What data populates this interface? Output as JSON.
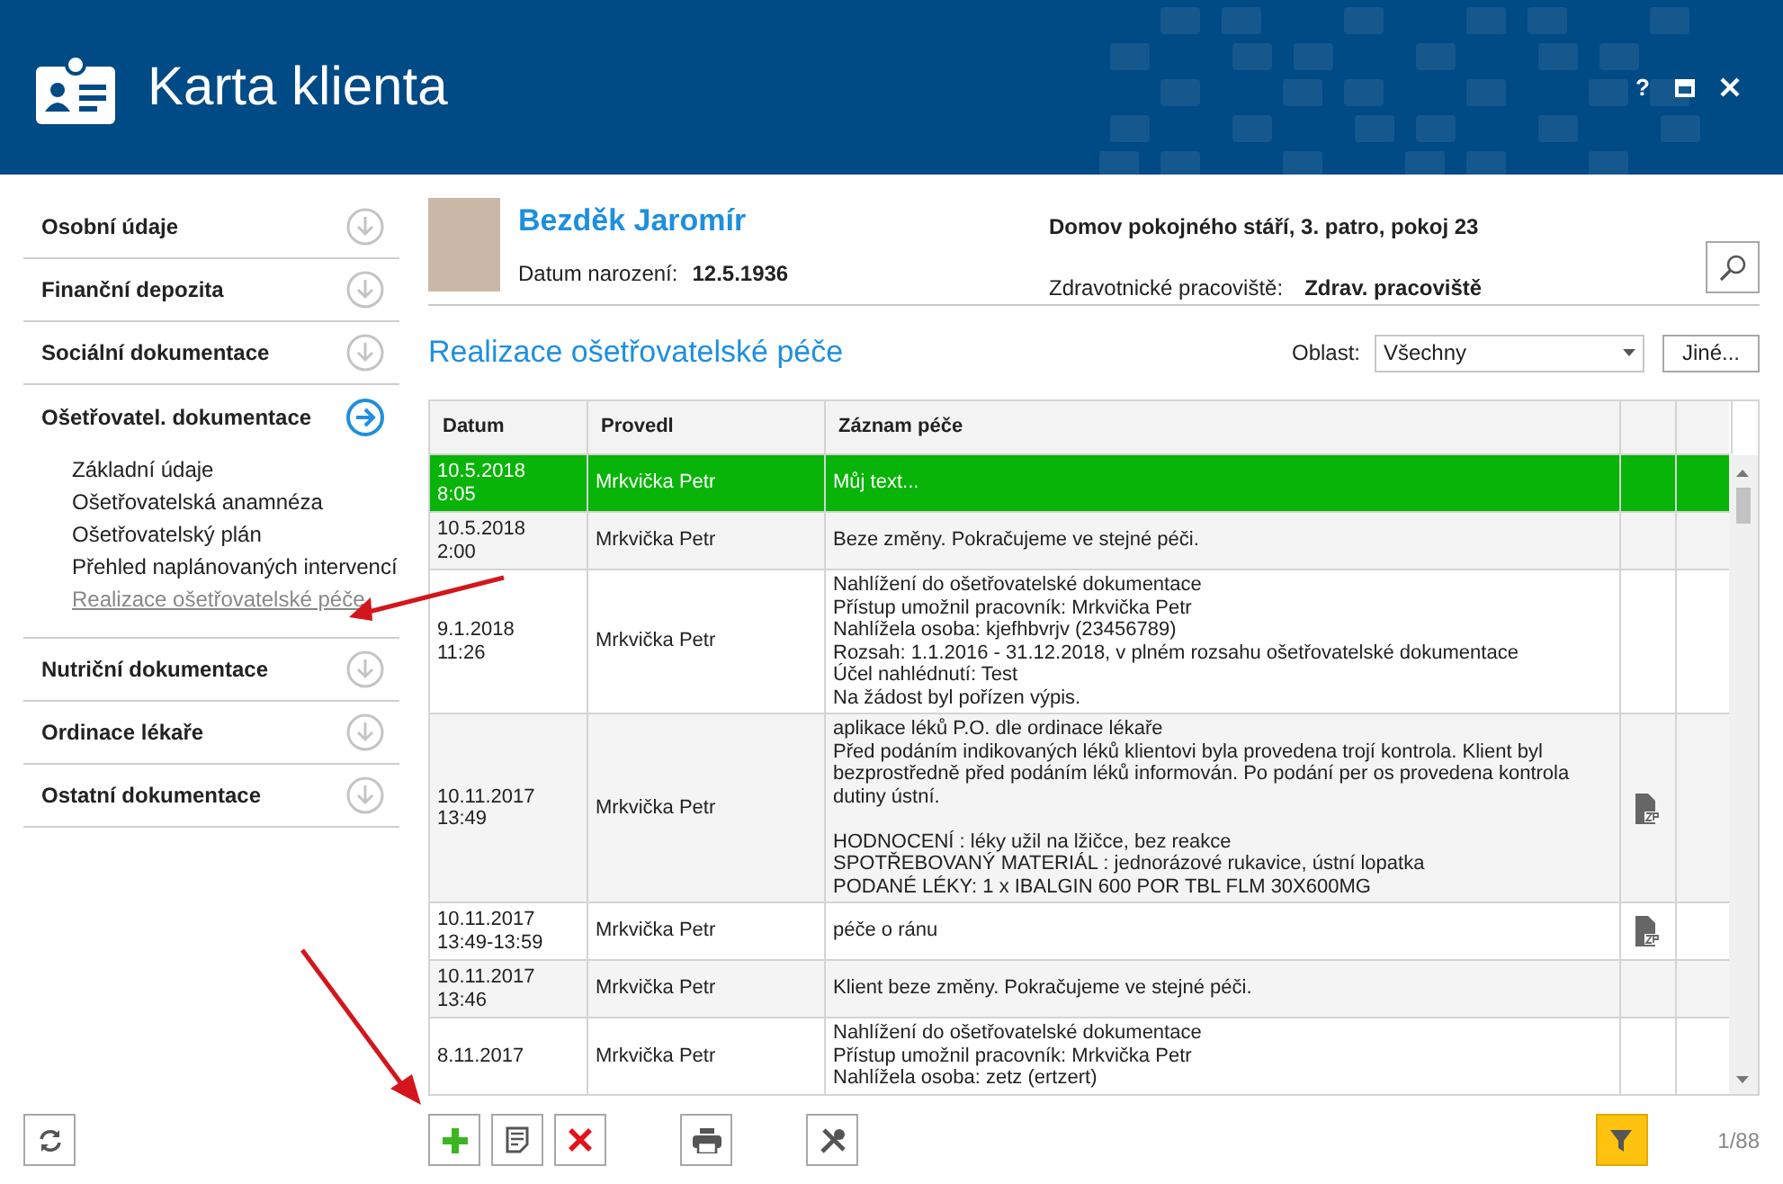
{
  "window": {
    "title": "Karta klienta",
    "help": "?"
  },
  "sidebar": {
    "sections": [
      {
        "label": "Osobní údaje",
        "expanded": false
      },
      {
        "label": "Finanční depozita",
        "expanded": false
      },
      {
        "label": "Sociální dokumentace",
        "expanded": false
      },
      {
        "label": "Ošetřovatel. dokumentace",
        "expanded": true,
        "children": [
          {
            "label": "Základní údaje",
            "selected": false
          },
          {
            "label": "Ošetřovatelská anamnéza",
            "selected": false
          },
          {
            "label": "Ošetřovatelský plán",
            "selected": false
          },
          {
            "label": "Přehled naplánovaných intervencí",
            "selected": false
          },
          {
            "label": "Realizace ošetřovatelské péče",
            "selected": true
          }
        ]
      },
      {
        "label": "Nutriční dokumentace",
        "expanded": false
      },
      {
        "label": "Ordinace lékaře",
        "expanded": false
      },
      {
        "label": "Ostatní dokumentace",
        "expanded": false
      }
    ]
  },
  "patient": {
    "name": "Bezděk Jaromír",
    "birth_label": "Datum narození:",
    "birth_date": "12.5.1936",
    "facility": "Domov pokojného stáří, 3. patro, pokoj 23",
    "workplace_label": "Zdravotnické pracoviště:",
    "workplace": "Zdrav. pracoviště"
  },
  "section_title": "Realizace ošetřovatelské péče",
  "filter": {
    "label": "Oblast:",
    "value": "Všechny"
  },
  "other_button": "Jiné...",
  "table": {
    "columns": [
      "Datum",
      "Provedl",
      "Záznam péče"
    ],
    "rows": [
      {
        "date": [
          "10.5.2018",
          "8:05"
        ],
        "by": "Mrkvička Petr",
        "record": [
          [
            "Můj text..."
          ]
        ],
        "attachment": false,
        "selected": true
      },
      {
        "date": [
          "10.5.2018",
          "2:00"
        ],
        "by": "Mrkvička Petr",
        "record": [
          [
            "Beze změny. Pokračujeme ve stejné péči."
          ]
        ],
        "attachment": false,
        "selected": false
      },
      {
        "date": [
          "9.1.2018",
          "11:26"
        ],
        "by": "Mrkvička Petr",
        "record": [
          [
            "Nahlížení do ošetřovatelské dokumentace",
            "Přístup umožnil pracovník: Mrkvička Petr",
            "Nahlížela osoba: kjefhbvrjv (23456789)",
            "Rozsah: 1.1.2016 - 31.12.2018, v plném rozsahu ošetřovatelské dokumentace",
            "Účel nahlédnutí: Test",
            "Na žádost byl pořízen výpis."
          ]
        ],
        "attachment": false,
        "selected": false
      },
      {
        "date": [
          "10.11.2017",
          "13:49"
        ],
        "by": "Mrkvička Petr",
        "record": [
          [
            "aplikace léků P.O. dle ordinace lékaře",
            "Před podáním indikovaných léků klientovi byla provedena trojí kontrola. Klient byl bezprostředně před podáním léků informován. Po podání per os provedena kontrola dutiny ústní."
          ],
          [
            "HODNOCENÍ : léky užil na lžičce, bez reakce",
            "SPOTŘEBOVANÝ MATERIÁL : jednorázové rukavice, ústní lopatka",
            "PODANÉ LÉKY: 1 x IBALGIN 600 POR TBL FLM 30X600MG"
          ]
        ],
        "attachment": true,
        "selected": false
      },
      {
        "date": [
          "10.11.2017",
          "13:49-13:59"
        ],
        "by": "Mrkvička Petr",
        "record": [
          [
            "péče o ránu"
          ]
        ],
        "attachment": true,
        "selected": false
      },
      {
        "date": [
          "10.11.2017",
          "13:46"
        ],
        "by": "Mrkvička Petr",
        "record": [
          [
            "Klient beze změny. Pokračujeme ve stejné péči."
          ]
        ],
        "attachment": false,
        "selected": false
      },
      {
        "date": [
          "8.11.2017"
        ],
        "by": "Mrkvička Petr",
        "record": [
          [
            "Nahlížení do ošetřovatelské dokumentace",
            "Přístup umožnil pracovník: Mrkvička Petr",
            "Nahlížela osoba: zetz (ertzert)"
          ]
        ],
        "attachment": false,
        "selected": false
      }
    ]
  },
  "footer": {
    "filter_active": true,
    "page": "1/88"
  }
}
